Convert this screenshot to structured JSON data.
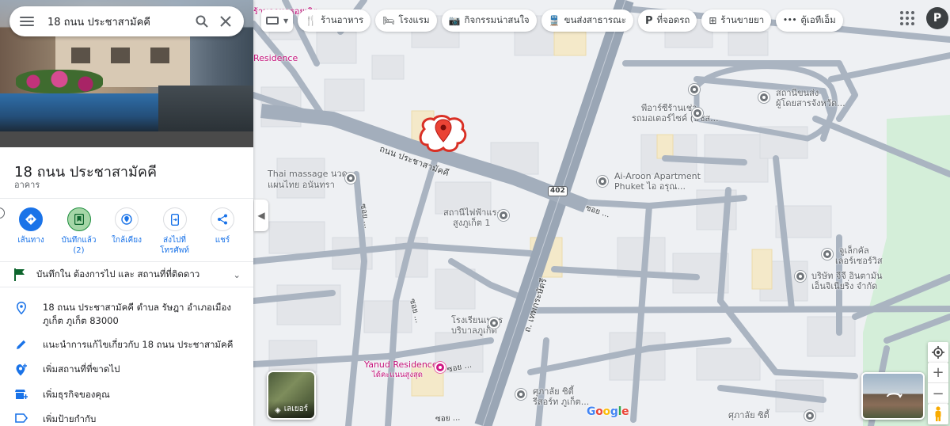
{
  "search": {
    "value": "18 ถนน ประชาสามัคคี"
  },
  "place": {
    "title": "18 ถนน ประชาสามัคคี",
    "type": "อาคาร"
  },
  "actions": [
    {
      "label": "เส้นทาง",
      "icon": "directions-icon"
    },
    {
      "label": "บันทึกแล้ว (2)",
      "icon": "bookmark-icon"
    },
    {
      "label": "ใกล้เคียง",
      "icon": "nearby-icon"
    },
    {
      "label": "ส่งไปที่โทรศัพท์",
      "icon": "send-to-phone-icon"
    },
    {
      "label": "แชร์",
      "icon": "share-icon"
    }
  ],
  "saved": {
    "text": "บันทึกใน ต้องการไป และ สถานที่ที่ติดดาว"
  },
  "info": {
    "address": "18 ถนน ประชาสามัคคี ตำบล รัษฎา อำเภอเมืองภูเก็ต ภูเก็ต 83000",
    "suggest_edit": "แนะนำการแก้ไขเกี่ยวกับ 18 ถนน ประชาสามัคคี",
    "add_missing": "เพิ่มสถานที่ที่ขาดไป",
    "add_business": "เพิ่มธุรกิจของคุณ",
    "add_label": "เพิ่มป้ายกำกับ"
  },
  "chips": [
    {
      "label": "ร้านอาหาร",
      "icon": "restaurant-icon"
    },
    {
      "label": "โรงแรม",
      "icon": "hotel-icon"
    },
    {
      "label": "กิจกรรมน่าสนใจ",
      "icon": "camera-icon"
    },
    {
      "label": "ขนส่งสาธารณะ",
      "icon": "transit-icon"
    },
    {
      "label": "ที่จอดรถ",
      "icon": "parking-icon"
    },
    {
      "label": "ร้านขายยา",
      "icon": "pharmacy-icon"
    },
    {
      "label": "ตู้เอทีเอ็ม",
      "icon": "atm-icon"
    }
  ],
  "user": {
    "initial": "P"
  },
  "map": {
    "labels": {
      "top_fragment": "ร้านอาหารอยเอิต",
      "residence_top": "Residence",
      "thai_massage_1": "Thai massage นวด",
      "thai_massage_2": "แผนไทย อนันทรา",
      "ai_aroon_1": "Ai-Aroon Apartment",
      "ai_aroon_2": "Phuket ไอ อรุณ...",
      "station_1": "สถานีไฟฟ้าแรง",
      "station_2": "สูงภูเก็ต 1",
      "school_1": "โรงเรียนเพชร",
      "school_2": "บริบาลภูเก็ต",
      "yanud_1": "Yanud Residence",
      "yanud_2": "ได้คะแนนสูงสุด",
      "court_1": "ศุภาลัย ซิตี้",
      "court_2": "รีสอร์ท ภูเก็ต...",
      "court_bottom": "ศุภาลัย ซิตี้",
      "showroom_1": "พีอาร์ซีร้านเช่า",
      "showroom_2": "รถมอเตอร์ไซค์ (บชส...",
      "transport_1": "สถานีขนส่ง",
      "transport_2": "ผู้โดยสารจังหวัด...",
      "jewelry_1": "จูเล็กคัล",
      "jewelry_2": "เลอร์เซอร์วิส",
      "company_1": "บริษัท จีจี อินตามัน",
      "company_2": "เอ็นจิเนียริ่ง จำกัด",
      "road_main": "ถนน ประชาสามัคคี",
      "road_thepkrasattri": "ถ. เทพกระษัตรี",
      "road_soi_1": "ซอย ...",
      "road_soi_2": "ซอย ...",
      "road_soi_3": "ซอย ...",
      "road_soi_4": "ซอย ...",
      "road_soi_bottom": "ซอย ...",
      "route_shield": "402"
    },
    "layers_label": "เลเยอร์",
    "google_logo": "Google",
    "colors": {
      "road": "#aab4c1",
      "major_road": "#9aa6b5",
      "park": "#d4eed9",
      "building": "#e4e6ea",
      "pin": "#ea4335",
      "highlight": "#d93025"
    }
  }
}
